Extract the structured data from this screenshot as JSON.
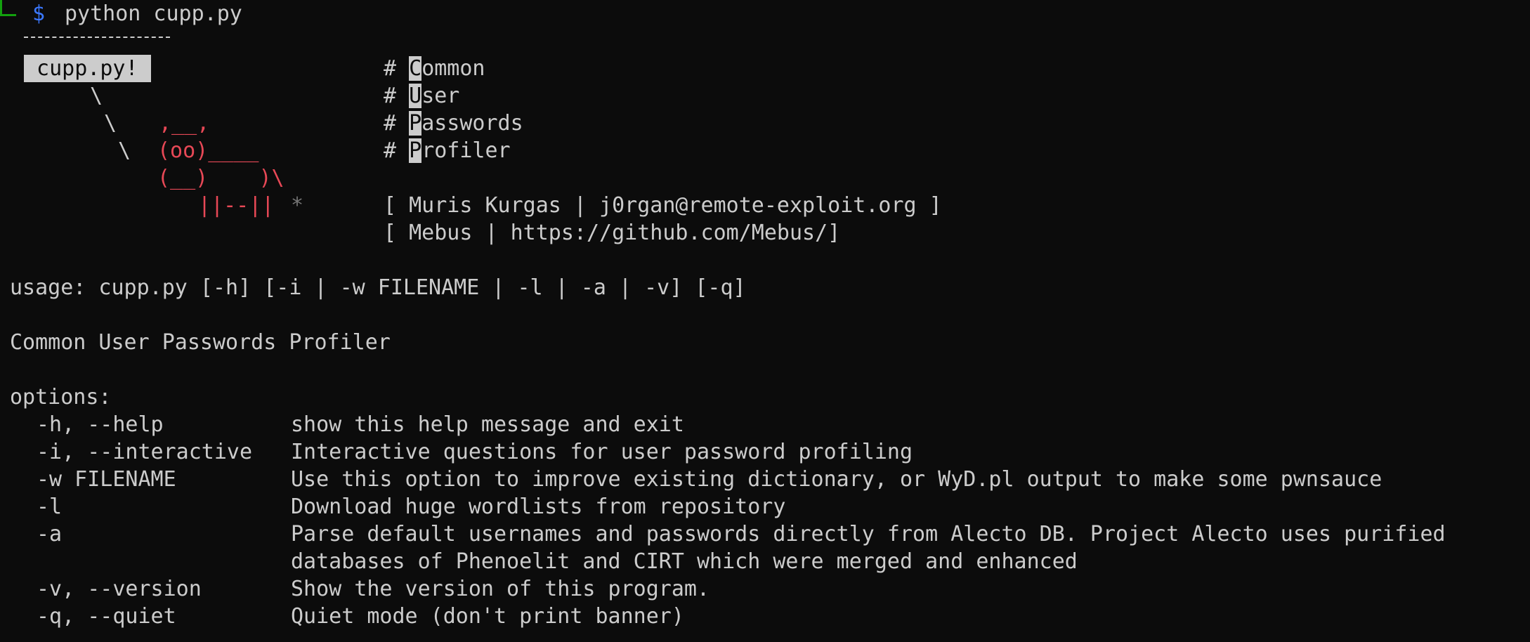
{
  "prompt": {
    "symbol": "$",
    "command": "python cupp.py"
  },
  "banner": {
    "bubble_text": " cupp.py! ",
    "slash1": "\\",
    "slash2": "\\",
    "slash3": "\\",
    "cow_horns": ",__,",
    "cow_face": "(oo)____",
    "cow_body": "(__)    )\\",
    "cow_legs": "||--||",
    "star": "*",
    "title_lines": [
      {
        "initial": "C",
        "rest": "ommon"
      },
      {
        "initial": "U",
        "rest": "ser"
      },
      {
        "initial": "P",
        "rest": "asswords"
      },
      {
        "initial": "P",
        "rest": "rofiler"
      }
    ],
    "credit1": "[ Muris Kurgas | j0rgan@remote-exploit.org ]",
    "credit2": "[ Mebus | https://github.com/Mebus/]"
  },
  "usage": "usage: cupp.py [-h] [-i | -w FILENAME | -l | -a | -v] [-q]",
  "description": "Common User Passwords Profiler",
  "options_header": "options:",
  "options": [
    {
      "flag": "-h, --help",
      "desc": "show this help message and exit"
    },
    {
      "flag": "-i, --interactive",
      "desc": "Interactive questions for user password profiling"
    },
    {
      "flag": "-w FILENAME",
      "desc": "Use this option to improve existing dictionary, or WyD.pl output to make some pwnsauce"
    },
    {
      "flag": "-l",
      "desc": "Download huge wordlists from repository"
    },
    {
      "flag": "-a",
      "desc": "Parse default usernames and passwords directly from Alecto DB. Project Alecto uses purified"
    },
    {
      "flag": "",
      "desc": "databases of Phenoelit and CIRT which were merged and enhanced"
    },
    {
      "flag": "-v, --version",
      "desc": "Show the version of this program."
    },
    {
      "flag": "-q, --quiet",
      "desc": "Quiet mode (don't print banner)"
    }
  ],
  "colors": {
    "background": "#0c0c0c",
    "foreground": "#cccccc",
    "prompt_blue": "#3b78ff",
    "cow_red": "#e74856",
    "prompt_green": "#13a10e"
  }
}
